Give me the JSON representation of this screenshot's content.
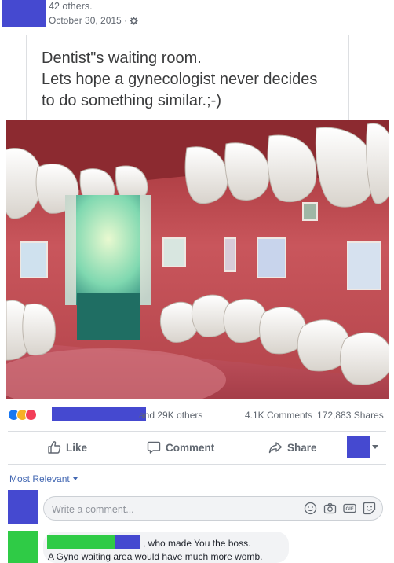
{
  "header": {
    "reactors_tail": "42 others.",
    "date": "October 30, 2015 ·",
    "privacy_icon": "gear-icon"
  },
  "shared_post": {
    "text": "Dentist\"s waiting room.\nLets hope a gynecologist never decides\nto do something similar.;-)"
  },
  "photo": {
    "description_icon": "photo",
    "colors": {
      "wall": "#c7555b",
      "teeth": "#f1efea"
    }
  },
  "reactions": {
    "icons": [
      "like-icon",
      "haha-icon",
      "love-icon"
    ],
    "others": "and 29K others",
    "comments": "4.1K Comments",
    "shares": "172,883 Shares"
  },
  "actions": {
    "like": "Like",
    "comment": "Comment",
    "share": "Share"
  },
  "comments_section": {
    "sort_label": "Most Relevant",
    "input_placeholder": "Write a comment...",
    "input_icons": [
      "emoji-icon",
      "camera-icon",
      "gif-icon",
      "sticker-icon"
    ],
    "items": [
      {
        "line1": ", who made You the boss.",
        "line2": "A Gyno waiting area would have much more womb."
      }
    ]
  },
  "colors": {
    "redaction_blue": "#4549d0",
    "redaction_green": "#2fcb46",
    "link_blue": "#4267b2"
  }
}
